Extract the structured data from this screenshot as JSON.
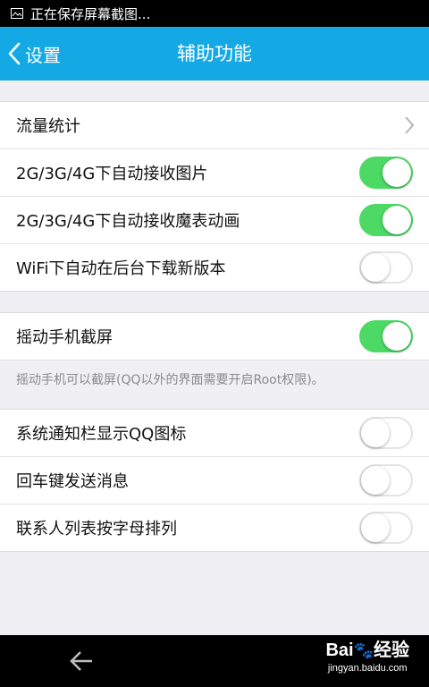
{
  "status_bar": {
    "text": "正在保存屏幕截图..."
  },
  "nav": {
    "back_label": "设置",
    "title": "辅助功能"
  },
  "group1": [
    {
      "label": "流量统计",
      "control": "chevron"
    },
    {
      "label": "2G/3G/4G下自动接收图片",
      "control": "toggle",
      "on": true
    },
    {
      "label": "2G/3G/4G下自动接收魔表动画",
      "control": "toggle",
      "on": true
    },
    {
      "label": "WiFi下自动在后台下载新版本",
      "control": "toggle",
      "on": false
    }
  ],
  "group2": [
    {
      "label": "摇动手机截屏",
      "control": "toggle",
      "on": true
    }
  ],
  "hint": "摇动手机可以截屏(QQ以外的界面需要开启Root权限)。",
  "group3": [
    {
      "label": "系统通知栏显示QQ图标",
      "control": "toggle",
      "on": false
    },
    {
      "label": "回车键发送消息",
      "control": "toggle",
      "on": false
    },
    {
      "label": "联系人列表按字母排列",
      "control": "toggle",
      "on": false
    }
  ],
  "watermark": {
    "brand": "Bai",
    "brand_suffix": "经验",
    "url": "jingyan.baidu.com"
  },
  "colors": {
    "accent": "#14a9e4",
    "toggle_on": "#4cd964",
    "background": "#efeff4"
  },
  "icons": {
    "status": "image-icon",
    "back": "chevron-left-icon",
    "row": "chevron-right-icon"
  }
}
